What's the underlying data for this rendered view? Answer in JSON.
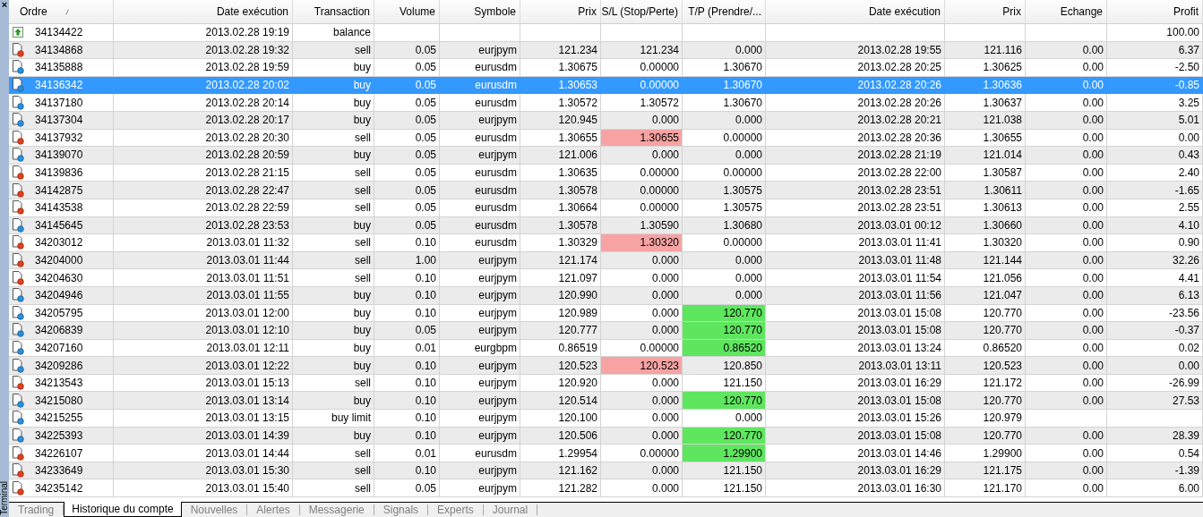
{
  "side_panel": {
    "close": "×",
    "title": "Terminal"
  },
  "table": {
    "columns": [
      {
        "label": "Ordre",
        "sorted": true
      },
      {
        "label": "Date exécution"
      },
      {
        "label": "Transaction"
      },
      {
        "label": "Volume"
      },
      {
        "label": "Symbole"
      },
      {
        "label": "Prix"
      },
      {
        "label": "S/L (Stop/Perte)"
      },
      {
        "label": "T/P (Prendre/..."
      },
      {
        "label": "Date exécution"
      },
      {
        "label": "Prix"
      },
      {
        "label": "Echange"
      },
      {
        "label": "Profit"
      }
    ],
    "rows": [
      {
        "kind": "balance",
        "selected": false,
        "sl_hit": false,
        "tp_hit": false,
        "cells": [
          "34134422",
          "2013.02.28 19:19",
          "balance",
          "",
          "",
          "",
          "",
          "",
          "",
          "",
          "",
          "100.00"
        ]
      },
      {
        "kind": "sell",
        "selected": false,
        "sl_hit": false,
        "tp_hit": false,
        "cells": [
          "34134868",
          "2013.02.28 19:32",
          "sell",
          "0.05",
          "eurjpym",
          "121.234",
          "121.234",
          "0.000",
          "2013.02.28 19:55",
          "121.116",
          "0.00",
          "6.37"
        ]
      },
      {
        "kind": "buy",
        "selected": false,
        "sl_hit": false,
        "tp_hit": false,
        "cells": [
          "34135888",
          "2013.02.28 19:59",
          "buy",
          "0.05",
          "eurusdm",
          "1.30675",
          "0.00000",
          "1.30670",
          "2013.02.28 20:25",
          "1.30625",
          "0.00",
          "-2.50"
        ]
      },
      {
        "kind": "buy",
        "selected": true,
        "sl_hit": false,
        "tp_hit": false,
        "cells": [
          "34136342",
          "2013.02.28 20:02",
          "buy",
          "0.05",
          "eurusdm",
          "1.30653",
          "0.00000",
          "1.30670",
          "2013.02.28 20:26",
          "1.30636",
          "0.00",
          "-0.85"
        ]
      },
      {
        "kind": "buy",
        "selected": false,
        "sl_hit": false,
        "tp_hit": false,
        "cells": [
          "34137180",
          "2013.02.28 20:14",
          "buy",
          "0.05",
          "eurusdm",
          "1.30572",
          "1.30572",
          "1.30670",
          "2013.02.28 20:26",
          "1.30637",
          "0.00",
          "3.25"
        ]
      },
      {
        "kind": "buy",
        "selected": false,
        "sl_hit": false,
        "tp_hit": false,
        "cells": [
          "34137304",
          "2013.02.28 20:17",
          "buy",
          "0.05",
          "eurjpym",
          "120.945",
          "0.000",
          "0.000",
          "2013.02.28 20:21",
          "121.038",
          "0.00",
          "5.01"
        ]
      },
      {
        "kind": "sell",
        "selected": false,
        "sl_hit": true,
        "tp_hit": false,
        "cells": [
          "34137932",
          "2013.02.28 20:30",
          "sell",
          "0.05",
          "eurusdm",
          "1.30655",
          "1.30655",
          "0.00000",
          "2013.02.28 20:36",
          "1.30655",
          "0.00",
          "0.00"
        ]
      },
      {
        "kind": "buy",
        "selected": false,
        "sl_hit": false,
        "tp_hit": false,
        "cells": [
          "34139070",
          "2013.02.28 20:59",
          "buy",
          "0.05",
          "eurjpym",
          "121.006",
          "0.000",
          "0.000",
          "2013.02.28 21:19",
          "121.014",
          "0.00",
          "0.43"
        ]
      },
      {
        "kind": "sell",
        "selected": false,
        "sl_hit": false,
        "tp_hit": false,
        "cells": [
          "34139836",
          "2013.02.28 21:15",
          "sell",
          "0.05",
          "eurusdm",
          "1.30635",
          "0.00000",
          "0.00000",
          "2013.02.28 22:00",
          "1.30587",
          "0.00",
          "2.40"
        ]
      },
      {
        "kind": "sell",
        "selected": false,
        "sl_hit": false,
        "tp_hit": false,
        "cells": [
          "34142875",
          "2013.02.28 22:47",
          "sell",
          "0.05",
          "eurusdm",
          "1.30578",
          "0.00000",
          "1.30575",
          "2013.02.28 23:51",
          "1.30611",
          "0.00",
          "-1.65"
        ]
      },
      {
        "kind": "sell",
        "selected": false,
        "sl_hit": false,
        "tp_hit": false,
        "cells": [
          "34143538",
          "2013.02.28 22:59",
          "sell",
          "0.05",
          "eurusdm",
          "1.30664",
          "0.00000",
          "1.30575",
          "2013.02.28 23:51",
          "1.30613",
          "0.00",
          "2.55"
        ]
      },
      {
        "kind": "buy",
        "selected": false,
        "sl_hit": false,
        "tp_hit": false,
        "cells": [
          "34145645",
          "2013.02.28 23:53",
          "buy",
          "0.05",
          "eurusdm",
          "1.30578",
          "1.30590",
          "1.30680",
          "2013.03.01 00:12",
          "1.30660",
          "0.00",
          "4.10"
        ]
      },
      {
        "kind": "sell",
        "selected": false,
        "sl_hit": true,
        "tp_hit": false,
        "cells": [
          "34203012",
          "2013.03.01 11:32",
          "sell",
          "0.10",
          "eurusdm",
          "1.30329",
          "1.30320",
          "0.00000",
          "2013.03.01 11:41",
          "1.30320",
          "0.00",
          "0.90"
        ]
      },
      {
        "kind": "sell",
        "selected": false,
        "sl_hit": false,
        "tp_hit": false,
        "cells": [
          "34204000",
          "2013.03.01 11:44",
          "sell",
          "1.00",
          "eurjpym",
          "121.174",
          "0.000",
          "0.000",
          "2013.03.01 11:48",
          "121.144",
          "0.00",
          "32.26"
        ]
      },
      {
        "kind": "sell",
        "selected": false,
        "sl_hit": false,
        "tp_hit": false,
        "cells": [
          "34204630",
          "2013.03.01 11:51",
          "sell",
          "0.10",
          "eurjpym",
          "121.097",
          "0.000",
          "0.000",
          "2013.03.01 11:54",
          "121.056",
          "0.00",
          "4.41"
        ]
      },
      {
        "kind": "buy",
        "selected": false,
        "sl_hit": false,
        "tp_hit": false,
        "cells": [
          "34204946",
          "2013.03.01 11:55",
          "buy",
          "0.10",
          "eurjpym",
          "120.990",
          "0.000",
          "0.000",
          "2013.03.01 11:56",
          "121.047",
          "0.00",
          "6.13"
        ]
      },
      {
        "kind": "buy",
        "selected": false,
        "sl_hit": false,
        "tp_hit": true,
        "cells": [
          "34205795",
          "2013.03.01 12:00",
          "buy",
          "0.10",
          "eurjpym",
          "120.989",
          "0.000",
          "120.770",
          "2013.03.01 15:08",
          "120.770",
          "0.00",
          "-23.56"
        ]
      },
      {
        "kind": "buy",
        "selected": false,
        "sl_hit": false,
        "tp_hit": true,
        "cells": [
          "34206839",
          "2013.03.01 12:10",
          "buy",
          "0.05",
          "eurjpym",
          "120.777",
          "0.000",
          "120.770",
          "2013.03.01 15:08",
          "120.770",
          "0.00",
          "-0.37"
        ]
      },
      {
        "kind": "buy",
        "selected": false,
        "sl_hit": false,
        "tp_hit": true,
        "cells": [
          "34207160",
          "2013.03.01 12:11",
          "buy",
          "0.01",
          "eurgbpm",
          "0.86519",
          "0.00000",
          "0.86520",
          "2013.03.01 13:24",
          "0.86520",
          "0.00",
          "0.02"
        ]
      },
      {
        "kind": "buy",
        "selected": false,
        "sl_hit": true,
        "tp_hit": false,
        "cells": [
          "34209286",
          "2013.03.01 12:22",
          "buy",
          "0.10",
          "eurjpym",
          "120.523",
          "120.523",
          "120.850",
          "2013.03.01 13:11",
          "120.523",
          "0.00",
          "0.00"
        ]
      },
      {
        "kind": "sell",
        "selected": false,
        "sl_hit": false,
        "tp_hit": false,
        "cells": [
          "34213543",
          "2013.03.01 15:13",
          "sell",
          "0.10",
          "eurjpym",
          "120.920",
          "0.000",
          "121.150",
          "2013.03.01 16:29",
          "121.172",
          "0.00",
          "-26.99"
        ]
      },
      {
        "kind": "buy",
        "selected": false,
        "sl_hit": false,
        "tp_hit": true,
        "cells": [
          "34215080",
          "2013.03.01 13:14",
          "buy",
          "0.10",
          "eurjpym",
          "120.514",
          "0.000",
          "120.770",
          "2013.03.01 15:08",
          "120.770",
          "0.00",
          "27.53"
        ]
      },
      {
        "kind": "buy",
        "selected": false,
        "sl_hit": false,
        "tp_hit": false,
        "cells": [
          "34215255",
          "2013.03.01 13:15",
          "buy limit",
          "0.10",
          "eurjpym",
          "120.100",
          "0.000",
          "0.000",
          "2013.03.01 15:26",
          "120.979",
          "",
          ""
        ]
      },
      {
        "kind": "buy",
        "selected": false,
        "sl_hit": false,
        "tp_hit": true,
        "cells": [
          "34225393",
          "2013.03.01 14:39",
          "buy",
          "0.10",
          "eurjpym",
          "120.506",
          "0.000",
          "120.770",
          "2013.03.01 15:08",
          "120.770",
          "0.00",
          "28.39"
        ]
      },
      {
        "kind": "sell",
        "selected": false,
        "sl_hit": false,
        "tp_hit": true,
        "cells": [
          "34226107",
          "2013.03.01 14:44",
          "sell",
          "0.01",
          "eurusdm",
          "1.29954",
          "0.00000",
          "1.29900",
          "2013.03.01 14:46",
          "1.29900",
          "0.00",
          "0.54"
        ]
      },
      {
        "kind": "sell",
        "selected": false,
        "sl_hit": false,
        "tp_hit": false,
        "cells": [
          "34233649",
          "2013.03.01 15:30",
          "sell",
          "0.10",
          "eurjpym",
          "121.162",
          "0.000",
          "121.150",
          "2013.03.01 16:29",
          "121.175",
          "0.00",
          "-1.39"
        ]
      },
      {
        "kind": "sell",
        "selected": false,
        "sl_hit": false,
        "tp_hit": false,
        "cells": [
          "34235142",
          "2013.03.01 15:40",
          "sell",
          "0.05",
          "eurjpym",
          "121.282",
          "0.000",
          "121.150",
          "2013.03.01 16:30",
          "121.170",
          "0.00",
          "6.00"
        ]
      }
    ]
  },
  "tabs": [
    {
      "label": "Trading",
      "selected": false
    },
    {
      "label": "Historique du compte",
      "selected": true
    },
    {
      "label": "Nouvelles",
      "selected": false
    },
    {
      "label": "Alertes",
      "selected": false
    },
    {
      "label": "Messagerie",
      "selected": false
    },
    {
      "label": "Signals",
      "selected": false
    },
    {
      "label": "Experts",
      "selected": false
    },
    {
      "label": "Journal",
      "selected": false
    }
  ]
}
